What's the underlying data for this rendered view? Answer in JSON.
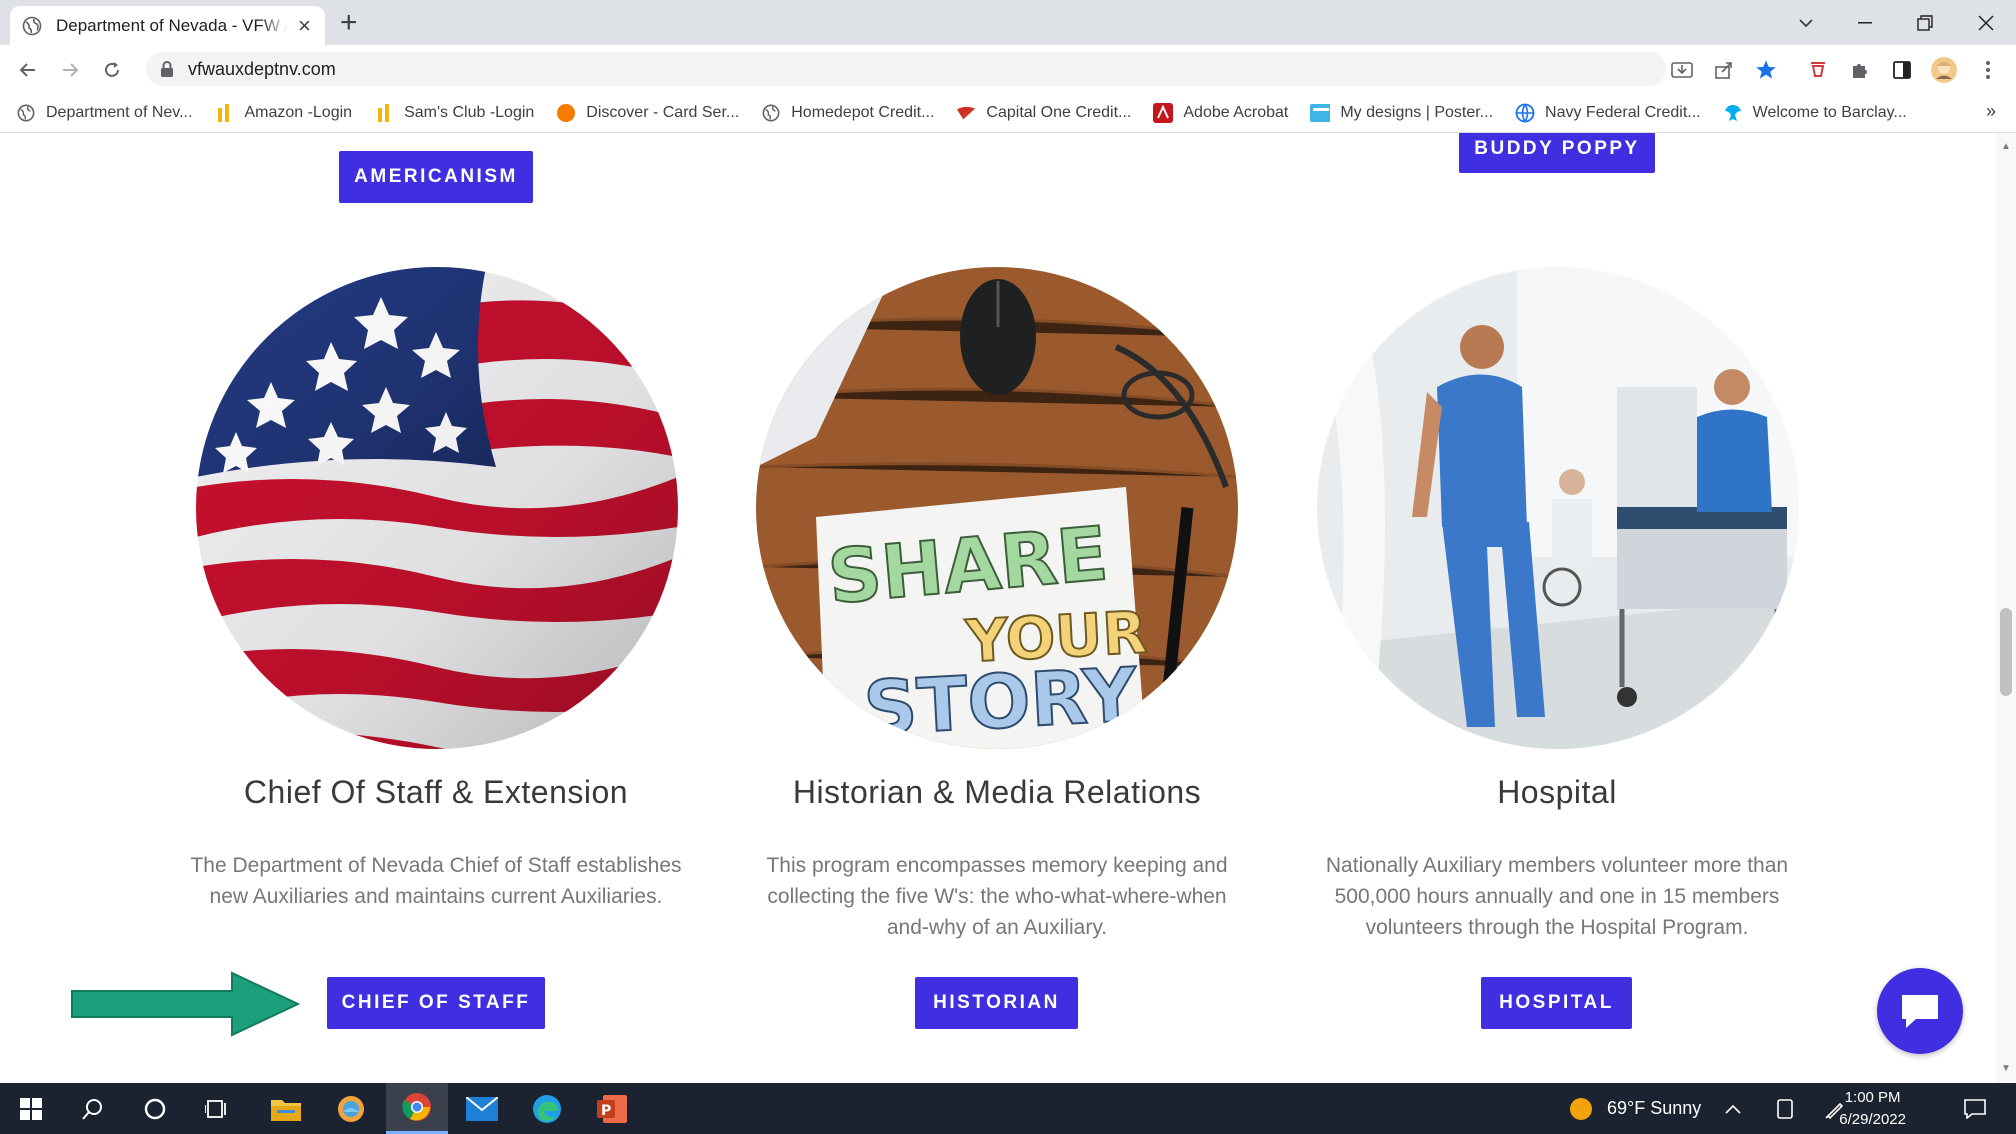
{
  "browser": {
    "tab_title": "Department of Nevada - VFW Auxiliary",
    "url": "vfwauxdeptnv.com",
    "bookmarks": [
      {
        "label": "Department of Nev...",
        "icon": "globe-icon"
      },
      {
        "label": "Amazon -Login",
        "icon": "amazon-icon"
      },
      {
        "label": "Sam's Club -Login",
        "icon": "samsclub-icon"
      },
      {
        "label": "Discover - Card Ser...",
        "icon": "discover-icon"
      },
      {
        "label": "Homedepot Credit...",
        "icon": "globe-icon"
      },
      {
        "label": "Capital One Credit...",
        "icon": "capitalone-icon"
      },
      {
        "label": "Adobe Acrobat",
        "icon": "acrobat-icon"
      },
      {
        "label": "My designs | Poster...",
        "icon": "postermywall-icon"
      },
      {
        "label": "Navy Federal Credit...",
        "icon": "globe-icon"
      },
      {
        "label": "Welcome to Barclay...",
        "icon": "barclays-icon"
      }
    ],
    "bookmarks_overflow": "»"
  },
  "page": {
    "top_buttons": {
      "americanism": "AMERICANISM",
      "buddy_poppy": "BUDDY POPPY"
    },
    "programs": [
      {
        "title": "Chief Of Staff & Extension",
        "description": "The Department of Nevada Chief of Staff establishes new Auxiliaries and maintains current Auxiliaries.",
        "button": "CHIEF OF STAFF",
        "image": "american-flag"
      },
      {
        "title": "Historian & Media Relations",
        "description": "This program encompasses memory keeping and collecting the five W's: the who-what-where-when and-why of an Auxiliary.",
        "button": "HISTORIAN",
        "image": "share-your-story",
        "image_text": [
          "SHARE",
          "YOUR",
          "STORY"
        ]
      },
      {
        "title": "Hospital",
        "description": "Nationally Auxiliary members volunteer more than 500,000 hours annually and one in 15 members volunteers through the Hospital Program.",
        "button": "HOSPITAL",
        "image": "hospital-staff"
      }
    ],
    "accent_color": "#3f2fe0",
    "arrow_color": "#1aa07a"
  },
  "taskbar": {
    "weather": "69°F  Sunny",
    "time": "1:00 PM",
    "date": "6/29/2022"
  }
}
